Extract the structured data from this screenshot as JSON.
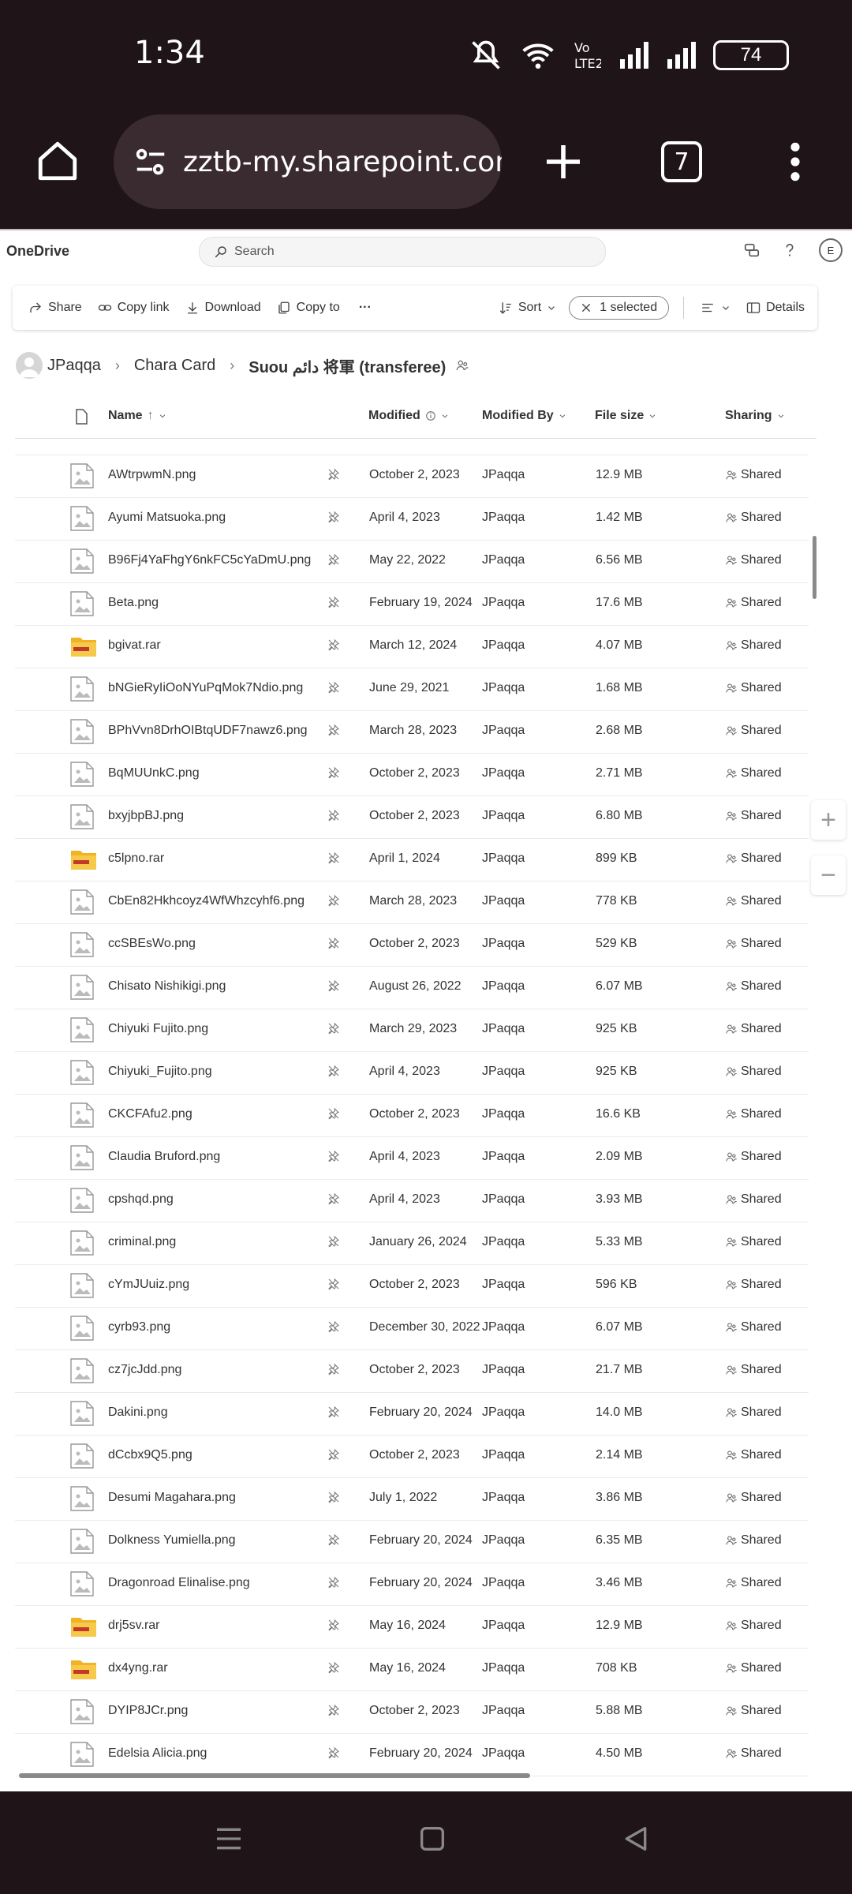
{
  "status_bar": {
    "time": "1:34",
    "battery": "74",
    "icons": [
      "mute-icon",
      "wifi-icon",
      "volte-icon",
      "signal-icon",
      "signal-icon",
      "battery-icon"
    ]
  },
  "browser": {
    "url": "zztb-my.sharepoint.com/p",
    "tab_count": "7"
  },
  "app": {
    "name": "OneDrive",
    "search_placeholder": "Search",
    "user_initial": "E"
  },
  "toolbar": {
    "share": "Share",
    "copy_link": "Copy link",
    "download": "Download",
    "copy_to": "Copy to",
    "more": "···",
    "sort": "Sort",
    "selected": "1 selected",
    "details": "Details"
  },
  "breadcrumb": {
    "items": [
      "JPaqqa",
      "Chara Card",
      "Suou دائم 将軍 (transferee)"
    ]
  },
  "table": {
    "columns": {
      "name": "Name",
      "modified": "Modified",
      "modified_by": "Modified By",
      "file_size": "File size",
      "sharing": "Sharing"
    },
    "rows": [
      {
        "name": "AWtrpwmN.png",
        "type": "image",
        "modified": "October 2, 2023",
        "by": "JPaqqa",
        "size": "12.9 MB",
        "sharing": "Shared"
      },
      {
        "name": "Ayumi Matsuoka.png",
        "type": "image",
        "modified": "April 4, 2023",
        "by": "JPaqqa",
        "size": "1.42 MB",
        "sharing": "Shared"
      },
      {
        "name": "B96Fj4YaFhgY6nkFC5cYaDmU.png",
        "type": "image",
        "modified": "May 22, 2022",
        "by": "JPaqqa",
        "size": "6.56 MB",
        "sharing": "Shared"
      },
      {
        "name": "Beta.png",
        "type": "image",
        "modified": "February 19, 2024",
        "by": "JPaqqa",
        "size": "17.6 MB",
        "sharing": "Shared"
      },
      {
        "name": "bgivat.rar",
        "type": "archive",
        "modified": "March 12, 2024",
        "by": "JPaqqa",
        "size": "4.07 MB",
        "sharing": "Shared"
      },
      {
        "name": "bNGieRyIiOoNYuPqMok7Ndio.png",
        "type": "image",
        "modified": "June 29, 2021",
        "by": "JPaqqa",
        "size": "1.68 MB",
        "sharing": "Shared"
      },
      {
        "name": "BPhVvn8DrhOIBtqUDF7nawz6.png",
        "type": "image",
        "modified": "March 28, 2023",
        "by": "JPaqqa",
        "size": "2.68 MB",
        "sharing": "Shared"
      },
      {
        "name": "BqMUUnkC.png",
        "type": "image",
        "modified": "October 2, 2023",
        "by": "JPaqqa",
        "size": "2.71 MB",
        "sharing": "Shared"
      },
      {
        "name": "bxyjbpBJ.png",
        "type": "image",
        "modified": "October 2, 2023",
        "by": "JPaqqa",
        "size": "6.80 MB",
        "sharing": "Shared"
      },
      {
        "name": "c5lpno.rar",
        "type": "archive",
        "modified": "April 1, 2024",
        "by": "JPaqqa",
        "size": "899 KB",
        "sharing": "Shared"
      },
      {
        "name": "CbEn82Hkhcoyz4WfWhzcyhf6.png",
        "type": "image",
        "modified": "March 28, 2023",
        "by": "JPaqqa",
        "size": "778 KB",
        "sharing": "Shared"
      },
      {
        "name": "ccSBEsWo.png",
        "type": "image",
        "modified": "October 2, 2023",
        "by": "JPaqqa",
        "size": "529 KB",
        "sharing": "Shared"
      },
      {
        "name": "Chisato Nishikigi.png",
        "type": "image",
        "modified": "August 26, 2022",
        "by": "JPaqqa",
        "size": "6.07 MB",
        "sharing": "Shared"
      },
      {
        "name": "Chiyuki Fujito.png",
        "type": "image",
        "modified": "March 29, 2023",
        "by": "JPaqqa",
        "size": "925 KB",
        "sharing": "Shared"
      },
      {
        "name": "Chiyuki_Fujito.png",
        "type": "image",
        "modified": "April 4, 2023",
        "by": "JPaqqa",
        "size": "925 KB",
        "sharing": "Shared"
      },
      {
        "name": "CKCFAfu2.png",
        "type": "image",
        "modified": "October 2, 2023",
        "by": "JPaqqa",
        "size": "16.6 KB",
        "sharing": "Shared"
      },
      {
        "name": "Claudia Bruford.png",
        "type": "image",
        "modified": "April 4, 2023",
        "by": "JPaqqa",
        "size": "2.09 MB",
        "sharing": "Shared"
      },
      {
        "name": "cpshqd.png",
        "type": "image",
        "modified": "April 4, 2023",
        "by": "JPaqqa",
        "size": "3.93 MB",
        "sharing": "Shared"
      },
      {
        "name": "criminal.png",
        "type": "image",
        "modified": "January 26, 2024",
        "by": "JPaqqa",
        "size": "5.33 MB",
        "sharing": "Shared"
      },
      {
        "name": "cYmJUuiz.png",
        "type": "image",
        "modified": "October 2, 2023",
        "by": "JPaqqa",
        "size": "596 KB",
        "sharing": "Shared"
      },
      {
        "name": "cyrb93.png",
        "type": "image",
        "modified": "December 30, 2022",
        "by": "JPaqqa",
        "size": "6.07 MB",
        "sharing": "Shared"
      },
      {
        "name": "cz7jcJdd.png",
        "type": "image",
        "modified": "October 2, 2023",
        "by": "JPaqqa",
        "size": "21.7 MB",
        "sharing": "Shared"
      },
      {
        "name": "Dakini.png",
        "type": "image",
        "modified": "February 20, 2024",
        "by": "JPaqqa",
        "size": "14.0 MB",
        "sharing": "Shared"
      },
      {
        "name": "dCcbx9Q5.png",
        "type": "image",
        "modified": "October 2, 2023",
        "by": "JPaqqa",
        "size": "2.14 MB",
        "sharing": "Shared"
      },
      {
        "name": "Desumi Magahara.png",
        "type": "image",
        "modified": "July 1, 2022",
        "by": "JPaqqa",
        "size": "3.86 MB",
        "sharing": "Shared"
      },
      {
        "name": "Dolkness Yumiella.png",
        "type": "image",
        "modified": "February 20, 2024",
        "by": "JPaqqa",
        "size": "6.35 MB",
        "sharing": "Shared"
      },
      {
        "name": "Dragonroad Elinalise.png",
        "type": "image",
        "modified": "February 20, 2024",
        "by": "JPaqqa",
        "size": "3.46 MB",
        "sharing": "Shared"
      },
      {
        "name": "drj5sv.rar",
        "type": "archive",
        "modified": "May 16, 2024",
        "by": "JPaqqa",
        "size": "12.9 MB",
        "sharing": "Shared"
      },
      {
        "name": "dx4yng.rar",
        "type": "archive",
        "modified": "May 16, 2024",
        "by": "JPaqqa",
        "size": "708 KB",
        "sharing": "Shared"
      },
      {
        "name": "DYIP8JCr.png",
        "type": "image",
        "modified": "October 2, 2023",
        "by": "JPaqqa",
        "size": "5.88 MB",
        "sharing": "Shared"
      },
      {
        "name": "Edelsia Alicia.png",
        "type": "image",
        "modified": "February 20, 2024",
        "by": "JPaqqa",
        "size": "4.50 MB",
        "sharing": "Shared"
      }
    ]
  },
  "zoom": {
    "in": "+",
    "out": "−"
  },
  "colors": {
    "chrome": "#1f1418",
    "url_pill": "#3a2b30",
    "folder": "#f0b323",
    "text": "#333333"
  }
}
